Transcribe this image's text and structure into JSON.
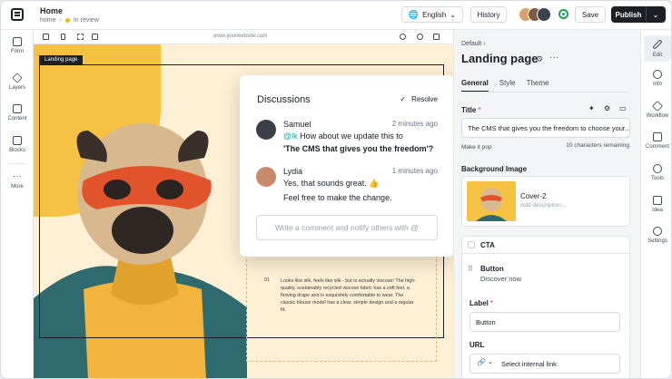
{
  "header": {
    "title": "Home",
    "breadcrumb": "home",
    "status": "In review",
    "language": "English",
    "history_label": "History",
    "save_label": "Save",
    "publish_label": "Publish"
  },
  "left_rail": [
    {
      "label": "Form",
      "icon": "form-icon"
    },
    {
      "label": "Layers",
      "icon": "layers-icon"
    },
    {
      "label": "Content",
      "icon": "content-icon"
    },
    {
      "label": "Blocks",
      "icon": "blocks-icon"
    },
    {
      "label": "More",
      "icon": "more-icon"
    }
  ],
  "canvas": {
    "url": "www.yourwebsite.com",
    "page_label": "Landing page",
    "card_number": "01",
    "card_text": "Looks like silk, feels like silk - but is actually viscose! The high-quality, sustainably recycled viscose fabric has a soft feel, a flowing drape and is exquisitely comfortable to wear. The classic blouse model has a clear, simple design and a regular fit."
  },
  "discussions": {
    "title": "Discussions",
    "resolve_label": "Resolve",
    "messages": [
      {
        "author": "Samuel",
        "time": "2 minutes ago",
        "mention": "@lk",
        "line1": " How about we update this to",
        "line2": "'The CMS that gives you the freedom'?"
      },
      {
        "author": "Lydia",
        "time": "1 minutes ago",
        "line1": "Yes, that sounds great. 👍",
        "line2": "Feel free to make the change."
      }
    ],
    "comment_placeholder": "Write a comment and notify others with @"
  },
  "panel": {
    "breadcrumb": "Default",
    "title": "Landing page",
    "tabs": [
      "General",
      "Style",
      "Theme"
    ],
    "title_label": "Title",
    "title_value": "The CMS that gives you the freedom to choose your...",
    "make_pop": "Make it pop",
    "chars_remaining": "10 characters remaining",
    "bg_label": "Background Image",
    "bg_name": "Cover-2",
    "bg_desc": "Add description...",
    "cta_label": "CTA",
    "button_label": "Button",
    "button_sub": "Discover now",
    "label_label": "Label",
    "label_value": "Button",
    "url_label": "URL",
    "url_value": "Select internal link"
  },
  "right_rail": [
    {
      "label": "Edit",
      "icon": "edit-icon"
    },
    {
      "label": "Info",
      "icon": "info-icon"
    },
    {
      "label": "Workflow",
      "icon": "workflow-icon"
    },
    {
      "label": "Comment",
      "icon": "comment-icon"
    },
    {
      "label": "Tools",
      "icon": "tools-icon"
    },
    {
      "label": "Idea",
      "icon": "idea-icon"
    },
    {
      "label": "Settings",
      "icon": "settings-icon"
    }
  ],
  "colors": {
    "accent": "#1c1f26",
    "mention": "#0ea5a4",
    "status_dot": "#f2b705",
    "online": "#16a34a",
    "hero_bg": "#f6c244"
  }
}
